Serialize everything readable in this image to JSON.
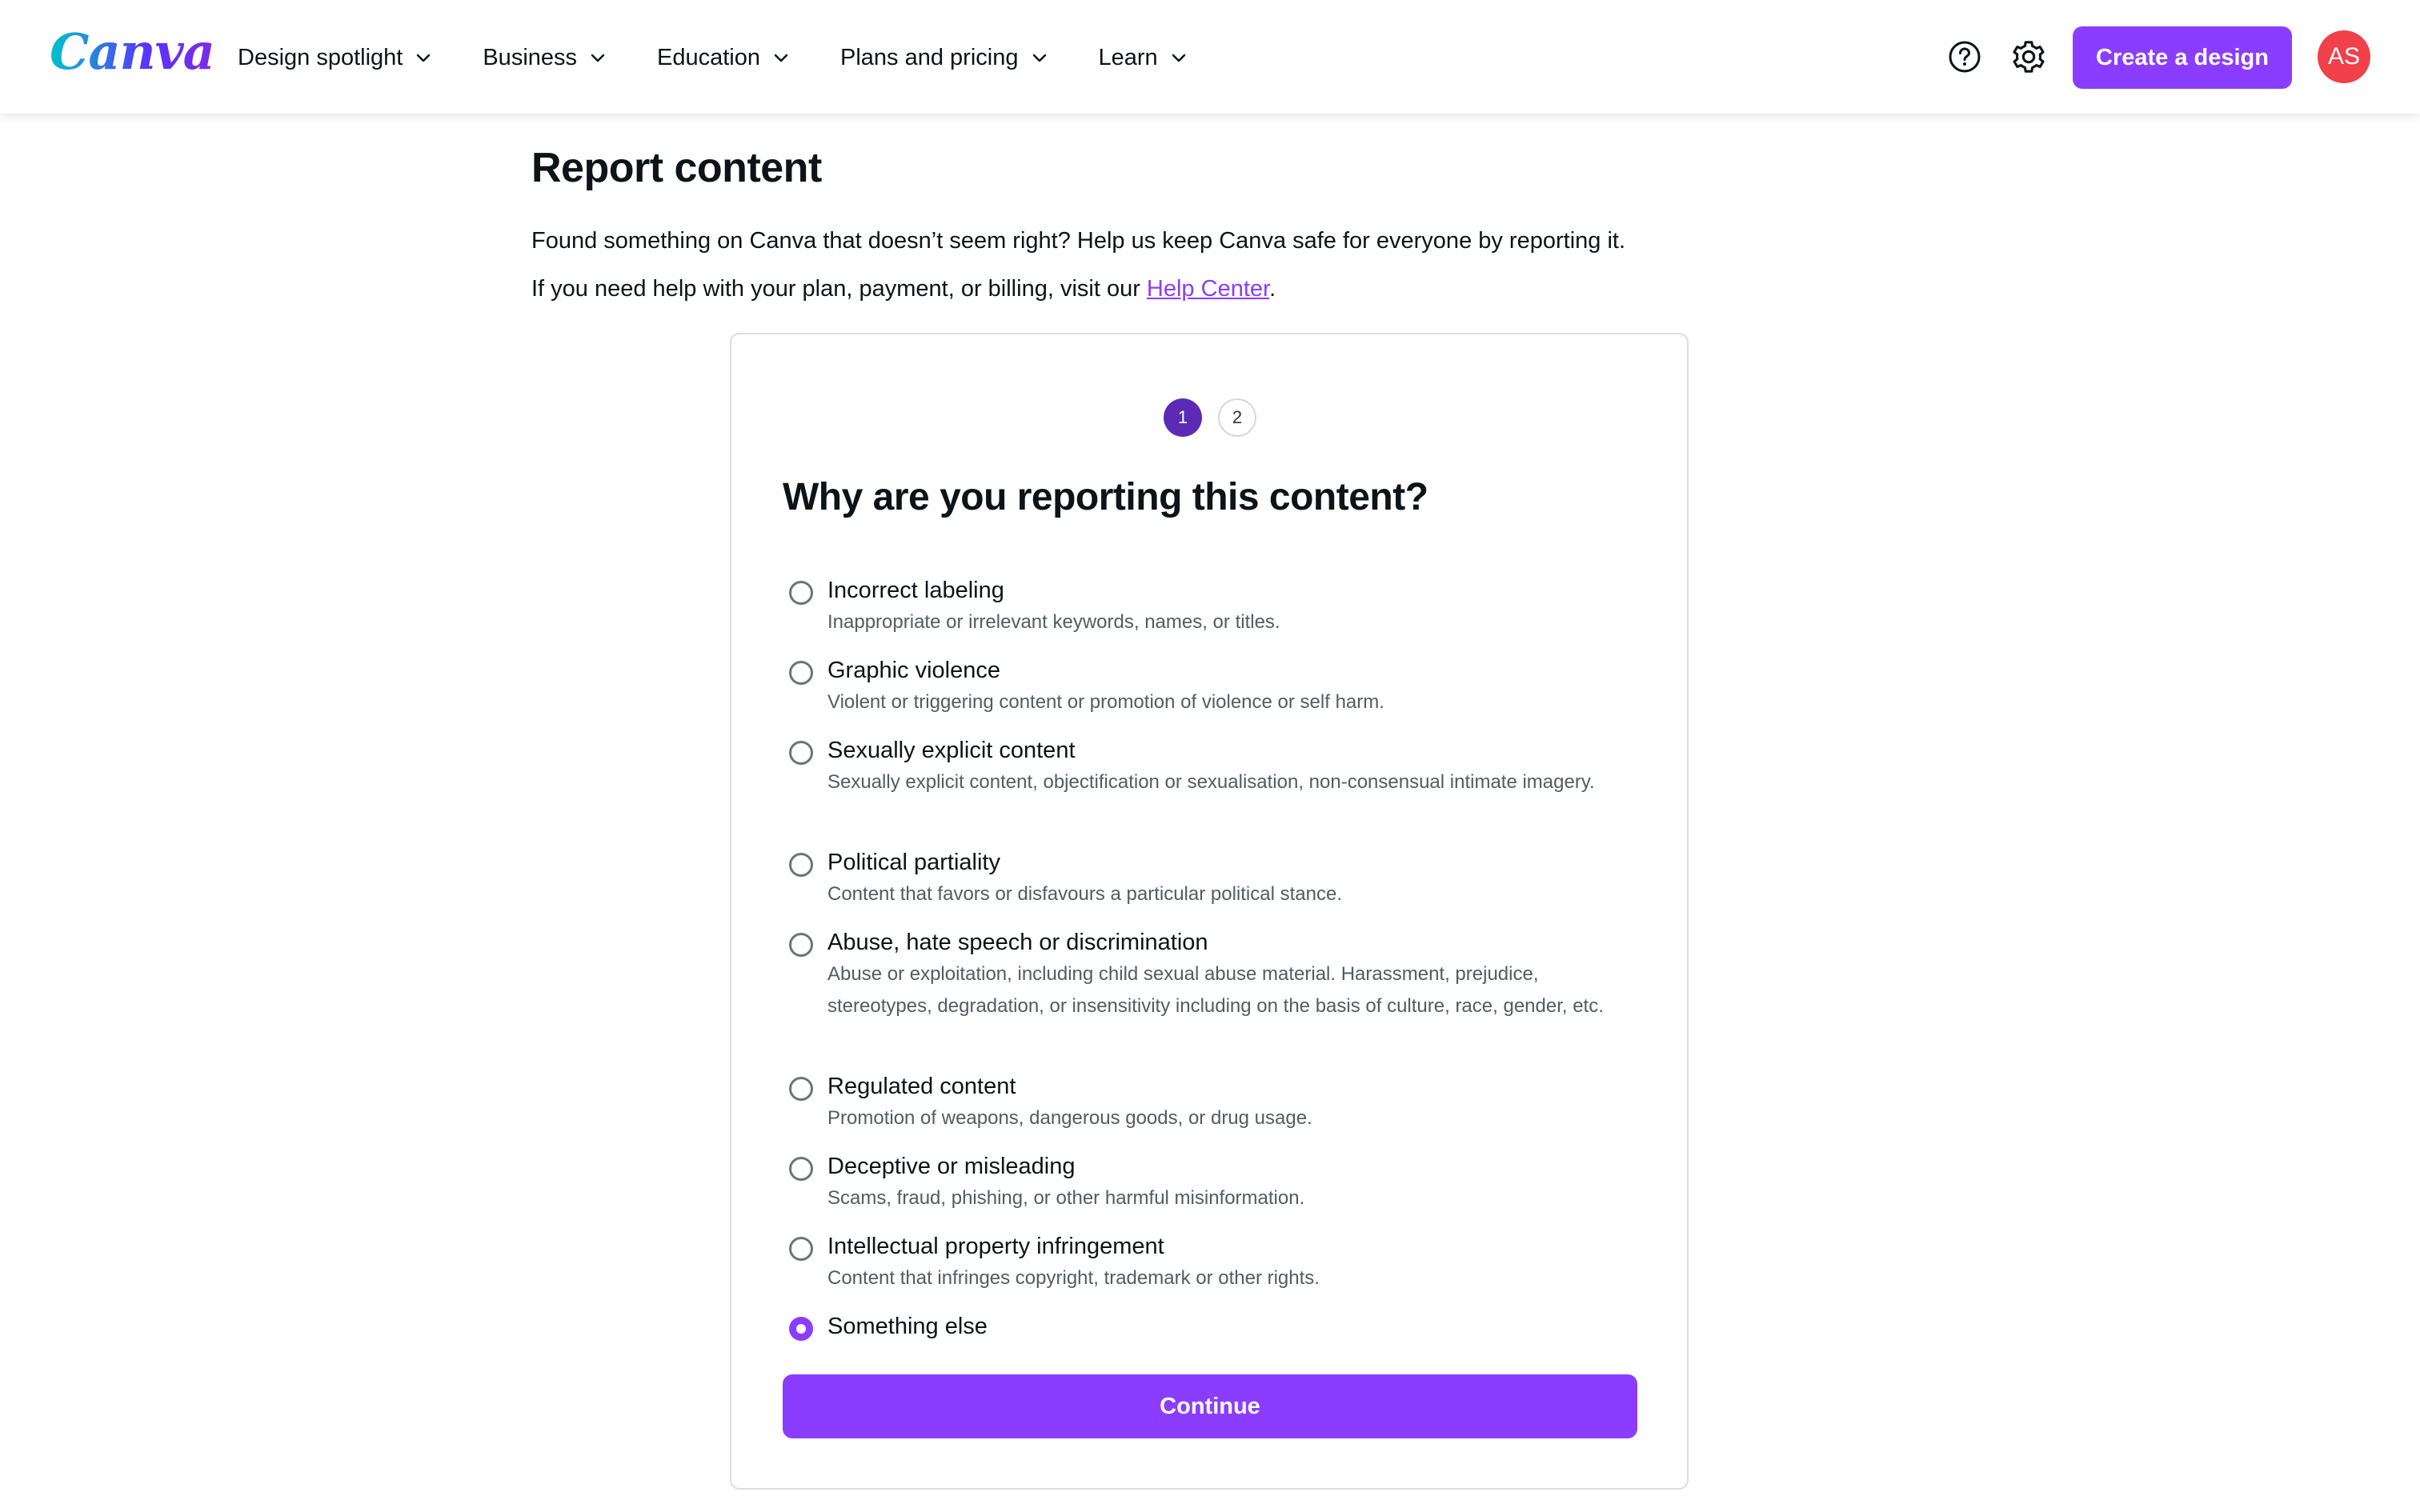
{
  "header": {
    "logo_text": "Canva",
    "nav": [
      {
        "label": "Design spotlight"
      },
      {
        "label": "Business"
      },
      {
        "label": "Education"
      },
      {
        "label": "Plans and pricing"
      },
      {
        "label": "Learn"
      }
    ],
    "help_icon": "help-circle-icon",
    "settings_icon": "gear-icon",
    "create_label": "Create a design",
    "avatar_initials": "AS",
    "brand_color": "#8b3dff",
    "avatar_color": "#f0404a"
  },
  "page": {
    "title": "Report content",
    "intro_1": "Found something on Canva that doesn’t seem right? Help us keep Canva safe for everyone by reporting it.",
    "intro_2_prefix": "If you need help with your plan, payment, or billing, visit our ",
    "help_link": "Help Center",
    "intro_2_suffix": "."
  },
  "form": {
    "steps": [
      "1",
      "2"
    ],
    "active_step": 1,
    "question": "Why are you reporting this content?",
    "options": [
      {
        "label": "Incorrect labeling",
        "desc": "Inappropriate or irrelevant keywords, names, or titles.",
        "checked": false
      },
      {
        "label": "Graphic violence",
        "desc": "Violent or triggering content or promotion of violence or self harm.",
        "checked": false
      },
      {
        "label": "Sexually explicit content",
        "desc": "Sexually explicit content, objectification or sexualisation, non-consensual intimate imagery.",
        "checked": false
      },
      {
        "label": "Political partiality",
        "desc": "Content that favors or disfavours a particular political stance.",
        "checked": false
      },
      {
        "label": "Abuse, hate speech or discrimination",
        "desc": "Abuse or exploitation, including child sexual abuse material. Harassment, prejudice, stereotypes, degradation, or insensitivity including on the basis of culture, race, gender, etc.",
        "checked": false
      },
      {
        "label": "Regulated content",
        "desc": "Promotion of weapons, dangerous goods, or drug usage.",
        "checked": false
      },
      {
        "label": "Deceptive or misleading",
        "desc": "Scams, fraud, phishing, or other harmful misinformation.",
        "checked": false
      },
      {
        "label": "Intellectual property infringement",
        "desc": "Content that infringes copyright, trademark or other rights.",
        "checked": false
      },
      {
        "label": "Something else",
        "desc": "",
        "checked": true
      }
    ],
    "continue_label": "Continue"
  }
}
